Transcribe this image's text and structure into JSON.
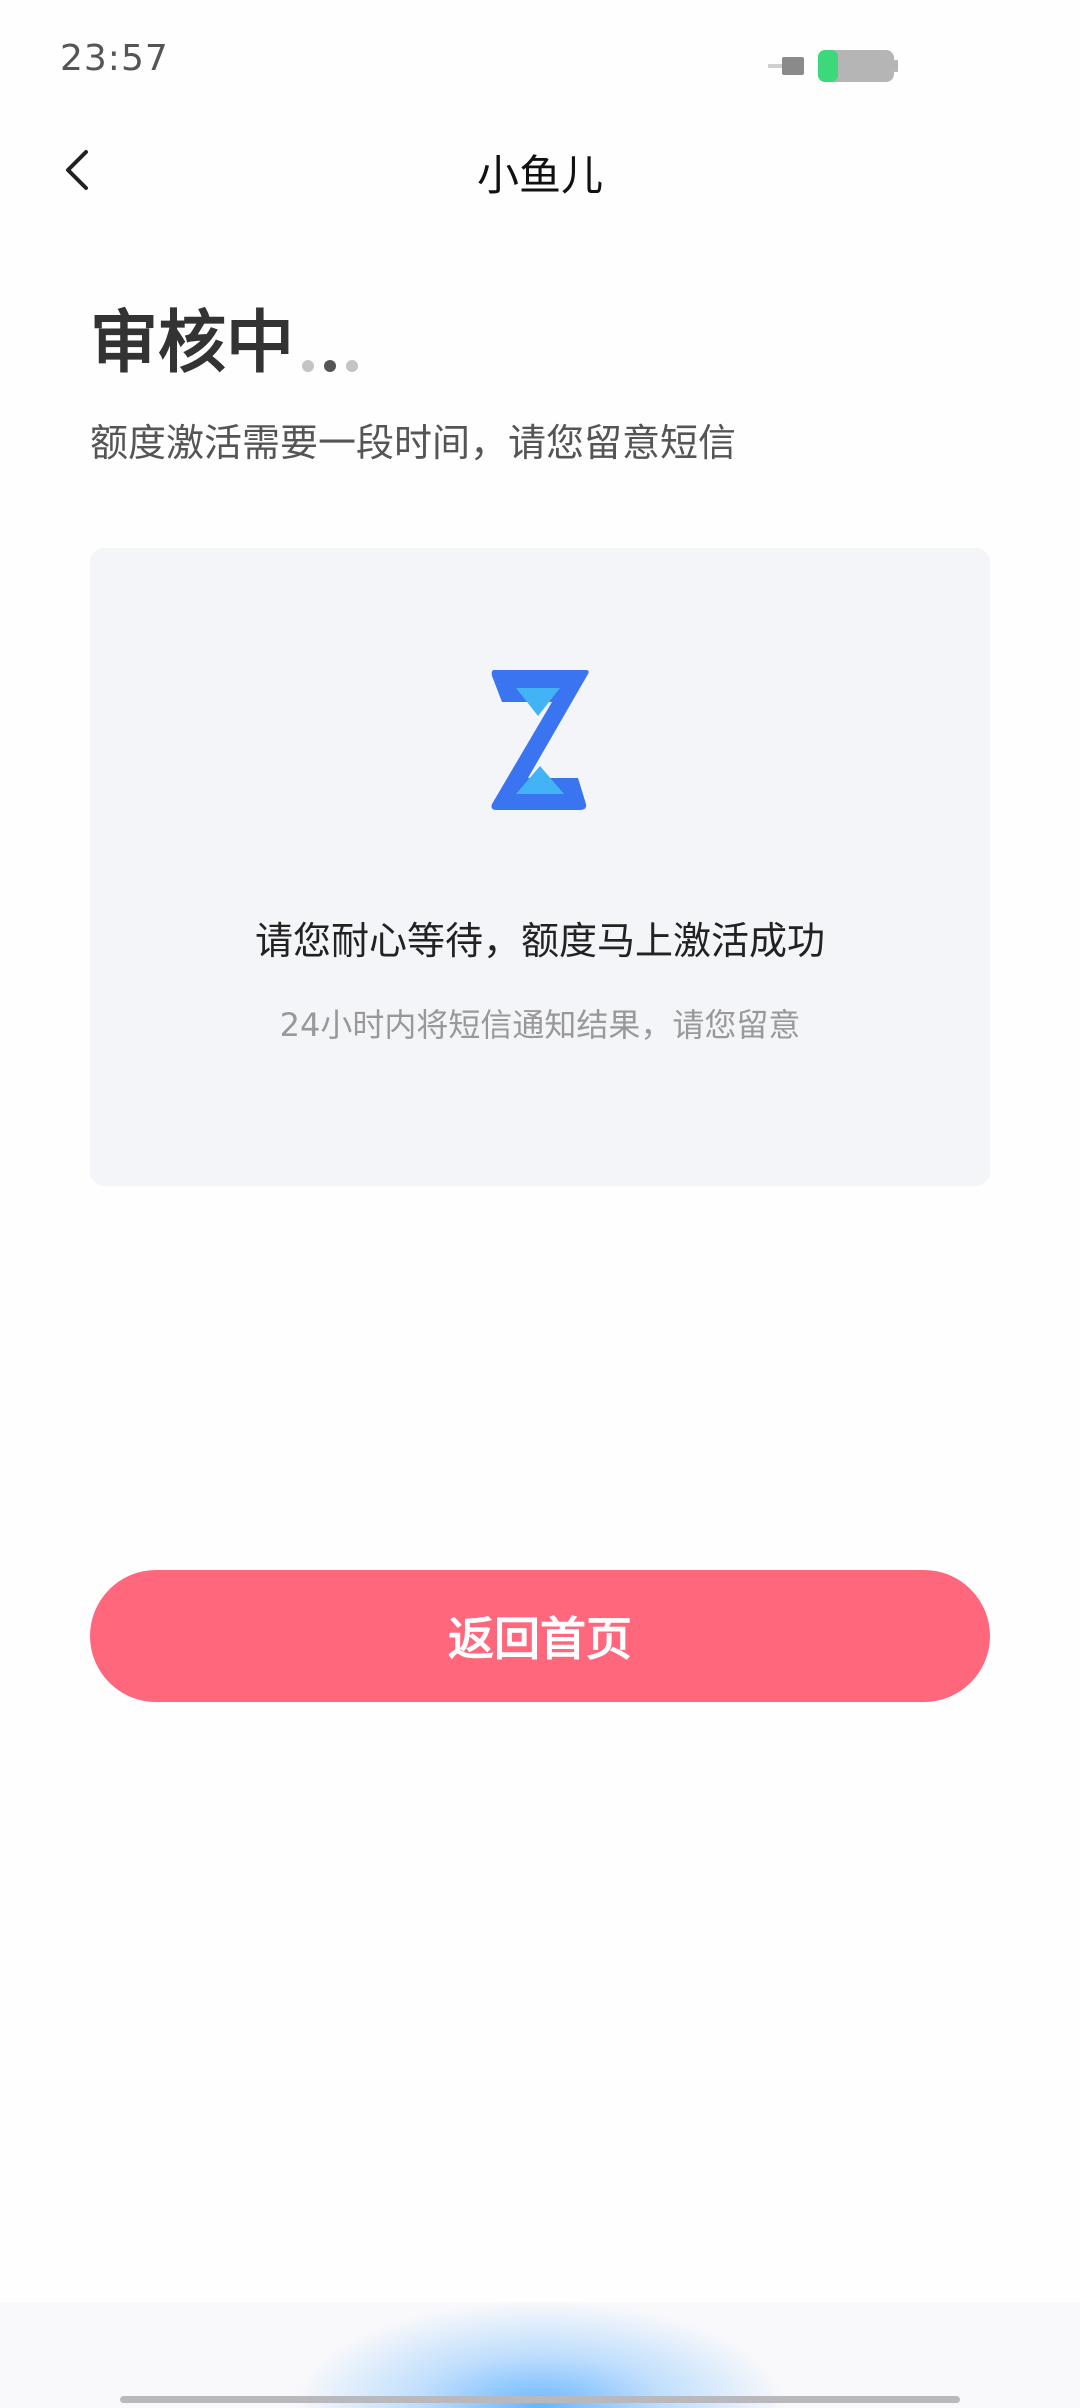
{
  "status_bar": {
    "time": "23:57",
    "battery_icon": "battery-charging-icon"
  },
  "nav": {
    "back_icon": "chevron-left-icon",
    "title": "小鱼儿"
  },
  "header": {
    "title": "审核中",
    "subtitle": "额度激活需要一段时间，请您留意短信"
  },
  "card": {
    "icon": "hourglass-icon",
    "title": "请您耐心等待，额度马上激活成功",
    "description": "24小时内将短信通知结果，请您留意"
  },
  "button": {
    "label": "返回首页"
  },
  "colors": {
    "accent_button": "#fe677c",
    "hourglass_blue": "#3b74f0",
    "hourglass_light": "#42b4f5",
    "card_bg": "#f4f5f8",
    "battery_green": "#3cd97a"
  }
}
